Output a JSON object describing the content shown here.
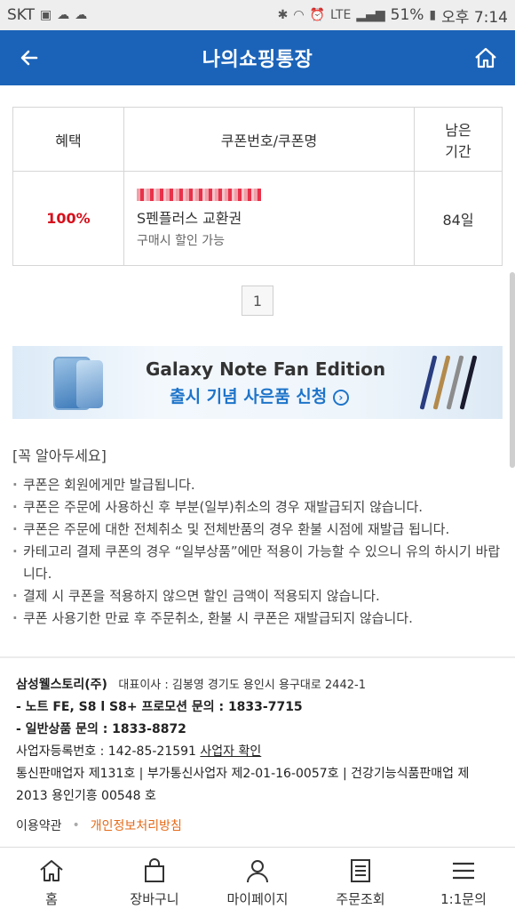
{
  "statusbar": {
    "carrier": "SKT",
    "network": "LTE",
    "battery": "51%",
    "time": "오후 7:14"
  },
  "header": {
    "title": "나의쇼핑통장"
  },
  "table": {
    "headers": [
      "혜택",
      "쿠폰번호/쿠폰명",
      "남은\n기간"
    ],
    "rows": [
      {
        "benefit": "100%",
        "coupon_name": "S펜플러스 교환권",
        "coupon_note": "구매시 할인 가능",
        "days": "84일"
      }
    ]
  },
  "pagination": {
    "current": "1"
  },
  "banner": {
    "line1": "Galaxy Note Fan Edition",
    "line2": "출시 기념 사은품 신청"
  },
  "notice": {
    "title": "[꼭 알아두세요]",
    "items": [
      "쿠폰은 회원에게만 발급됩니다.",
      "쿠폰은 주문에 사용하신 후 부분(일부)취소의 경우 재발급되지 않습니다.",
      "쿠폰은 주문에 대한 전체취소 및 전체반품의 경우 환불 시점에 재발급 됩니다.",
      "카테고리 결제 쿠폰의 경우 “일부상품”에만 적용이 가능할 수 있으니 유의 하시기 바랍니다.",
      "결제 시 쿠폰을 적용하지 않으면 할인 금액이 적용되지 않습니다.",
      "쿠폰 사용기한 만료 후 주문취소, 환불 시 쿠폰은 재발급되지 않습니다."
    ]
  },
  "company": {
    "name": "삼성웰스토리(주)",
    "ceo_address": "대표이사 : 김봉영   경기도 용인시 용구대로 2442-1",
    "inquiry1": "- 노트 FE, S8 l S8+ 프로모션 문의 : 1833-7715",
    "inquiry2": "- 일반상품 문의 : 1833-8872",
    "biz_number": "사업자등록번호 : 142-85-21591",
    "biz_link": "사업자 확인",
    "license": "통신판매업자 제131호 | 부가통신사업자 제2-01-16-0057호 | 건강기능식품판매업 제 2013 용인기흥 00548 호"
  },
  "footer_links": {
    "terms": "이용약관",
    "privacy": "개인정보처리방침"
  },
  "bottom_nav": [
    {
      "label": "홈",
      "icon": "home-icon"
    },
    {
      "label": "장바구니",
      "icon": "cart-icon"
    },
    {
      "label": "마이페이지",
      "icon": "user-icon"
    },
    {
      "label": "주문조회",
      "icon": "order-list-icon"
    },
    {
      "label": "1:1문의",
      "icon": "menu-icon"
    }
  ],
  "colors": {
    "header_bg": "#1b63b8",
    "benefit": "#d6101c",
    "privacy_link": "#e56a18"
  }
}
